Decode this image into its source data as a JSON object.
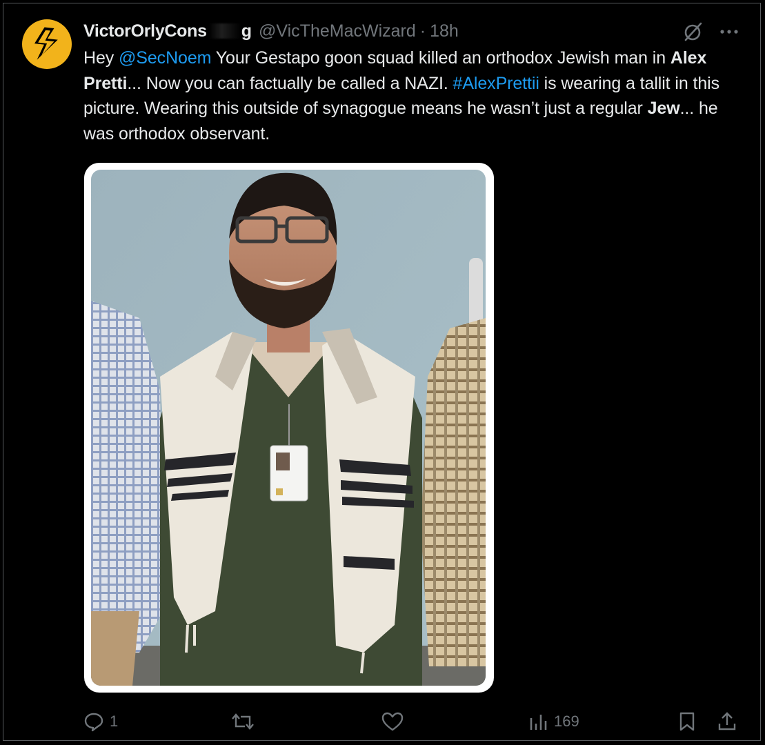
{
  "tweet": {
    "display_name": "VictorOrlyCons",
    "display_name_tail": "g",
    "handle": "@VicTheMacWizard",
    "separator": "·",
    "time": "18h",
    "text": {
      "p1": "Hey ",
      "mention": "@SecNoem",
      "p2": " Your Gestapo goon squad killed an orthodox Jewish man in ",
      "bold1": "Alex Pretti",
      "p3": "... Now you can factually be called a NAZI. ",
      "hashtag": "#AlexPrettii",
      "p4": " is wearing a tallit in this picture. Wearing this outside of synagogue means he wasn’t just a regular ",
      "bold2": "Jew",
      "p5": "... he was orthodox observant."
    }
  },
  "icons": {
    "avatar": "lightning-bolt-icon",
    "top_right": [
      "grok-icon",
      "more-icon"
    ],
    "actions": [
      "reply-icon",
      "retweet-icon",
      "like-icon",
      "views-icon",
      "bookmark-icon",
      "share-icon"
    ]
  },
  "stats": {
    "replies": "1",
    "retweets": "",
    "likes": "",
    "views": "169"
  },
  "colors": {
    "background": "#000000",
    "text": "#e7e9ea",
    "muted": "#71767b",
    "link": "#1d9bf0",
    "avatar": "#f2b31b"
  }
}
